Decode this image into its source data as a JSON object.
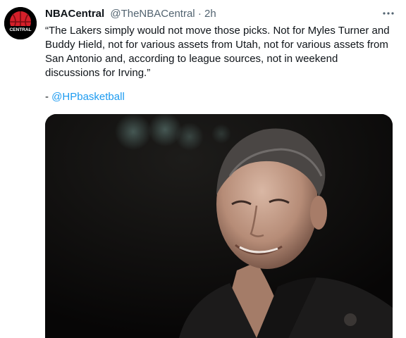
{
  "tweet": {
    "display_name": "NBACentral",
    "handle": "@TheNBACentral",
    "separator": "·",
    "time": "2h",
    "more_icon": "ellipsis-icon",
    "text": "“The Lakers simply would not move those picks. Not for Myles Turner and Buddy Hield, not for various assets from Utah, not for various assets from San Antonio and, according to league sources, not in weekend discussions for Irving.”",
    "credit_prefix": "-",
    "credit_mention": "@HPbasketball"
  },
  "avatar": {
    "logo_text": "CENTRAL",
    "colors": {
      "background": "#000000",
      "ball": "#d4202a",
      "ball_dark": "#7a0d12"
    }
  },
  "colors": {
    "text": "#0f1419",
    "secondary": "#536471",
    "link": "#1d9bf0"
  }
}
